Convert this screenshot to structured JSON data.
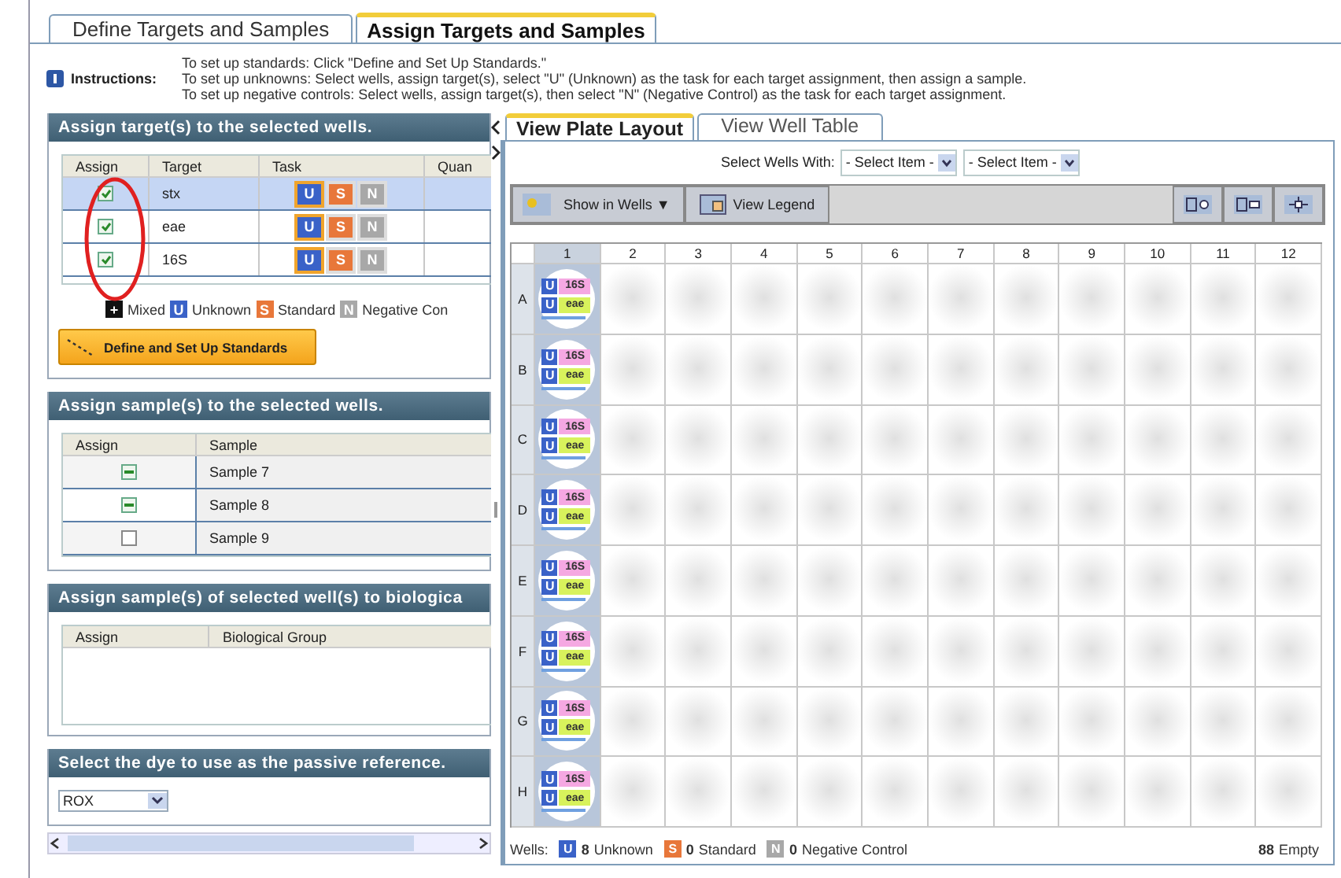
{
  "tabs": [
    {
      "label": "Define Targets and Samples",
      "selected": false
    },
    {
      "label": "Assign Targets and Samples",
      "selected": true
    }
  ],
  "instructions": {
    "label": "Instructions:",
    "lines": [
      "To set up standards: Click \"Define and Set Up Standards.\"",
      "To set up unknowns: Select wells, assign target(s), select \"U\" (Unknown) as the task for each target assignment, then assign a sample.",
      "To set up negative controls: Select wells, assign target(s), then select \"N\" (Negative Control) as the task for each target assignment."
    ]
  },
  "targets_section": {
    "title": "Assign target(s) to the selected wells.",
    "columns": [
      "Assign",
      "Target",
      "Task",
      "Quan"
    ],
    "rows": [
      {
        "checked": true,
        "name": "stx",
        "selected": true,
        "tasks": [
          {
            "label": "U",
            "selected": true
          },
          {
            "label": "S",
            "selected": false
          },
          {
            "label": "N",
            "selected": false
          }
        ]
      },
      {
        "checked": true,
        "name": "eae",
        "selected": false,
        "tasks": [
          {
            "label": "U",
            "selected": true
          },
          {
            "label": "S",
            "selected": false
          },
          {
            "label": "N",
            "selected": false
          }
        ]
      },
      {
        "checked": true,
        "name": "16S",
        "selected": false,
        "tasks": [
          {
            "label": "U",
            "selected": true
          },
          {
            "label": "S",
            "selected": false
          },
          {
            "label": "N",
            "selected": false
          }
        ]
      }
    ],
    "legend": [
      {
        "icon": "+",
        "label": "Mixed",
        "color": "#111111"
      },
      {
        "icon": "U",
        "label": "Unknown",
        "color": "#3a62c8"
      },
      {
        "icon": "S",
        "label": "Standard",
        "color": "#e8773a"
      },
      {
        "icon": "N",
        "label": "Negative Con",
        "color": "#a8a8a8"
      }
    ],
    "button": "Define and Set Up Standards"
  },
  "samples_section": {
    "title": "Assign sample(s) to the selected wells.",
    "columns": [
      "Assign",
      "Sample"
    ],
    "rows": [
      {
        "partial": true,
        "name": "Sample 7"
      },
      {
        "partial": true,
        "name": "Sample 8"
      },
      {
        "partial": false,
        "name": "Sample 9"
      }
    ]
  },
  "groups_section": {
    "title": "Assign sample(s) of selected well(s) to biologica",
    "columns": [
      "Assign",
      "Biological Group"
    ]
  },
  "dye_section": {
    "title": "Select the dye to use as the passive reference.",
    "value": "ROX"
  },
  "plate_view": {
    "tabs": [
      {
        "label": "View Plate Layout",
        "selected": true
      },
      {
        "label": "View Well Table",
        "selected": false
      }
    ],
    "select_label": "Select Wells With:",
    "selects": [
      "- Select Item -",
      "- Select Item -"
    ],
    "show_in_wells": "Show in Wells ▼",
    "view_legend": "View Legend",
    "plate": {
      "columns": [
        {
          "label": "1",
          "selected": true
        },
        {
          "label": "2",
          "selected": false
        },
        {
          "label": "3",
          "selected": false
        },
        {
          "label": "4",
          "selected": false
        },
        {
          "label": "5",
          "selected": false
        },
        {
          "label": "6",
          "selected": false
        },
        {
          "label": "7",
          "selected": false
        },
        {
          "label": "8",
          "selected": false
        },
        {
          "label": "9",
          "selected": false
        },
        {
          "label": "10",
          "selected": false
        },
        {
          "label": "11",
          "selected": false
        },
        {
          "label": "12",
          "selected": false
        }
      ],
      "rows": [
        {
          "label": "A",
          "wells": [
            {
              "selected": true,
              "targets": [
                {
                  "task": "U",
                  "name": "16S",
                  "color": "#f5a8e2"
                },
                {
                  "task": "U",
                  "name": "eae",
                  "color": "#d8f25c"
                }
              ]
            },
            {
              "selected": false
            },
            {
              "selected": false
            },
            {
              "selected": false
            },
            {
              "selected": false
            },
            {
              "selected": false
            },
            {
              "selected": false
            },
            {
              "selected": false
            },
            {
              "selected": false
            },
            {
              "selected": false
            },
            {
              "selected": false
            },
            {
              "selected": false
            }
          ]
        },
        {
          "label": "B",
          "wells": [
            {
              "selected": true,
              "targets": [
                {
                  "task": "U",
                  "name": "16S",
                  "color": "#f5a8e2"
                },
                {
                  "task": "U",
                  "name": "eae",
                  "color": "#d8f25c"
                }
              ]
            },
            {
              "selected": false
            },
            {
              "selected": false
            },
            {
              "selected": false
            },
            {
              "selected": false
            },
            {
              "selected": false
            },
            {
              "selected": false
            },
            {
              "selected": false
            },
            {
              "selected": false
            },
            {
              "selected": false
            },
            {
              "selected": false
            },
            {
              "selected": false
            }
          ]
        },
        {
          "label": "C",
          "wells": [
            {
              "selected": true,
              "targets": [
                {
                  "task": "U",
                  "name": "16S",
                  "color": "#f5a8e2"
                },
                {
                  "task": "U",
                  "name": "eae",
                  "color": "#d8f25c"
                }
              ]
            },
            {
              "selected": false
            },
            {
              "selected": false
            },
            {
              "selected": false
            },
            {
              "selected": false
            },
            {
              "selected": false
            },
            {
              "selected": false
            },
            {
              "selected": false
            },
            {
              "selected": false
            },
            {
              "selected": false
            },
            {
              "selected": false
            },
            {
              "selected": false
            }
          ]
        },
        {
          "label": "D",
          "wells": [
            {
              "selected": true,
              "targets": [
                {
                  "task": "U",
                  "name": "16S",
                  "color": "#f5a8e2"
                },
                {
                  "task": "U",
                  "name": "eae",
                  "color": "#d8f25c"
                }
              ]
            },
            {
              "selected": false
            },
            {
              "selected": false
            },
            {
              "selected": false
            },
            {
              "selected": false
            },
            {
              "selected": false
            },
            {
              "selected": false
            },
            {
              "selected": false
            },
            {
              "selected": false
            },
            {
              "selected": false
            },
            {
              "selected": false
            },
            {
              "selected": false
            }
          ]
        },
        {
          "label": "E",
          "wells": [
            {
              "selected": true,
              "targets": [
                {
                  "task": "U",
                  "name": "16S",
                  "color": "#f5a8e2"
                },
                {
                  "task": "U",
                  "name": "eae",
                  "color": "#d8f25c"
                }
              ]
            },
            {
              "selected": false
            },
            {
              "selected": false
            },
            {
              "selected": false
            },
            {
              "selected": false
            },
            {
              "selected": false
            },
            {
              "selected": false
            },
            {
              "selected": false
            },
            {
              "selected": false
            },
            {
              "selected": false
            },
            {
              "selected": false
            },
            {
              "selected": false
            }
          ]
        },
        {
          "label": "F",
          "wells": [
            {
              "selected": true,
              "targets": [
                {
                  "task": "U",
                  "name": "16S",
                  "color": "#f5a8e2"
                },
                {
                  "task": "U",
                  "name": "eae",
                  "color": "#d8f25c"
                }
              ]
            },
            {
              "selected": false
            },
            {
              "selected": false
            },
            {
              "selected": false
            },
            {
              "selected": false
            },
            {
              "selected": false
            },
            {
              "selected": false
            },
            {
              "selected": false
            },
            {
              "selected": false
            },
            {
              "selected": false
            },
            {
              "selected": false
            },
            {
              "selected": false
            }
          ]
        },
        {
          "label": "G",
          "wells": [
            {
              "selected": true,
              "targets": [
                {
                  "task": "U",
                  "name": "16S",
                  "color": "#f5a8e2"
                },
                {
                  "task": "U",
                  "name": "eae",
                  "color": "#d8f25c"
                }
              ]
            },
            {
              "selected": false
            },
            {
              "selected": false
            },
            {
              "selected": false
            },
            {
              "selected": false
            },
            {
              "selected": false
            },
            {
              "selected": false
            },
            {
              "selected": false
            },
            {
              "selected": false
            },
            {
              "selected": false
            },
            {
              "selected": false
            },
            {
              "selected": false
            }
          ]
        },
        {
          "label": "H",
          "wells": [
            {
              "selected": true,
              "targets": [
                {
                  "task": "U",
                  "name": "16S",
                  "color": "#f5a8e2"
                },
                {
                  "task": "U",
                  "name": "eae",
                  "color": "#d8f25c"
                }
              ]
            },
            {
              "selected": false
            },
            {
              "selected": false
            },
            {
              "selected": false
            },
            {
              "selected": false
            },
            {
              "selected": false
            },
            {
              "selected": false
            },
            {
              "selected": false
            },
            {
              "selected": false
            },
            {
              "selected": false
            },
            {
              "selected": false
            },
            {
              "selected": false
            }
          ]
        }
      ]
    },
    "footer": {
      "label": "Wells:",
      "counts": [
        {
          "icon": "U",
          "count": "8",
          "label": "Unknown",
          "color": "#3a62c8"
        },
        {
          "icon": "S",
          "count": "0",
          "label": "Standard",
          "color": "#e8773a"
        },
        {
          "icon": "N",
          "count": "0",
          "label": "Negative Control",
          "color": "#a8a8a8"
        }
      ],
      "empty_count": "88",
      "empty_label": "Empty"
    }
  }
}
